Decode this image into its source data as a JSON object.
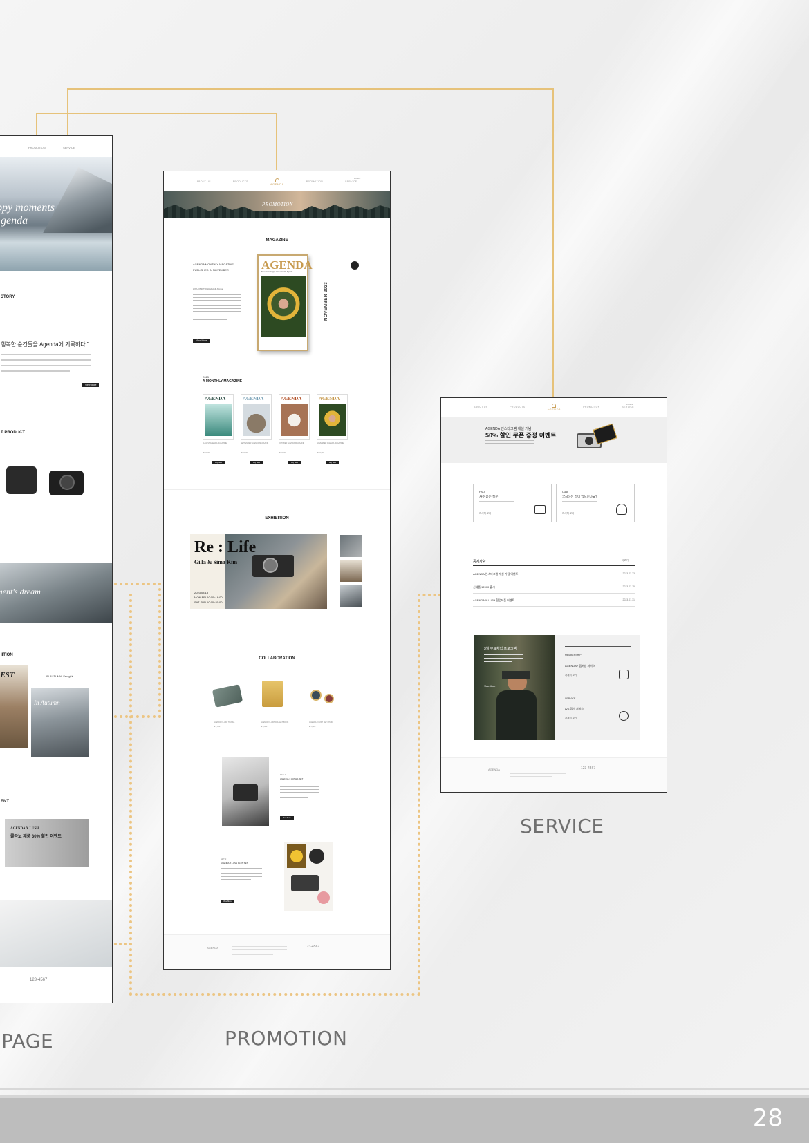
{
  "labels": {
    "page": "PAGE",
    "promotion": "PROMOTION",
    "service": "SERVICE"
  },
  "page_number": "28",
  "colors": {
    "connector": "#e6c27a",
    "dotted": "#ecc583",
    "footer_band": "#bdbdbd"
  },
  "left_mockup": {
    "story_heading": "STORY",
    "story_quote": "행복한 순간들을 Agenda에 기록하다.\"",
    "product_heading": "T PRODUCT",
    "exhibition_heading": "IITION",
    "event_heading": "ENT",
    "hero_text": "ppy moments",
    "hero_text2": "genda",
    "dream_text": "ment's dream",
    "forest_text": "REST",
    "autumn_title": "IN AUTUMN, Seulgi K",
    "autumn_art": "In Autumn",
    "event_title": "AGENDA X LUSH",
    "event_sub": "콜라보 제품 30% 할인 이벤트",
    "phone": "123-4567",
    "view_more": "View More"
  },
  "promo_mockup": {
    "nav": [
      "ABOUT US",
      "PRODUCTS",
      "PROMOTION",
      "SERVICE"
    ],
    "logo": "AGENDA",
    "login": "LOGIN",
    "banner": "PROMOTION",
    "magazine_heading": "MAGAZINE",
    "magazine_title1": "AGENDA MONTHLY MAGAZINE",
    "magazine_title2": "PUBLISHED IN NOVEMBER",
    "magazine_with": "WITH PHOTOGRAPHER Agnes",
    "cover_title": "AGENDA",
    "cover_sub": "To record a happy moments with Agenda",
    "vertical_text": "NOVEMBER 2023",
    "view_more": "View More",
    "monthly_year": "2023",
    "monthly_heading": "A MONTHLY MAGAZINE",
    "magazines": [
      {
        "name": "AUGUST AGENDA MAGAZINE",
        "price": "₩ 15,000",
        "btn": "Buy Now"
      },
      {
        "name": "SEPTEMBER AGENDA MAGAZINE",
        "price": "₩ 15,000",
        "btn": "Buy Now"
      },
      {
        "name": "OCTOBER AGENDA MAGAZINE",
        "price": "₩ 15,000",
        "btn": "Buy Now"
      },
      {
        "name": "NOVEMBER AGENDA MAGAZINE",
        "price": "₩ 15,000",
        "btn": "Buy Now"
      }
    ],
    "mag_cover": "AGENDA",
    "exhibition_heading": "EXHIBITION",
    "exhibit_title": "Re : Life",
    "exhibit_artist": "Gilla & Sima Kim",
    "exhibit_date": "2023.03.13",
    "exhibit_hours1": "MON-FRI 10:00~18:00",
    "exhibit_hours2": "SAT-SUN 10:00~20:00",
    "collaboration_heading": "COLLABORATION",
    "collab_items": [
      {
        "name": "AGENDA X LUSH TRAVEL",
        "price": "₩ 7,000"
      },
      {
        "name": "AGENDA X LUSH COLLECT BOOK",
        "price": "₩ 9,000"
      },
      {
        "name": "AGENDA X LUSH KEY CHAIN",
        "price": "₩ 5,000"
      }
    ],
    "set1_label": "SET 1",
    "set1_title": "AGENDA X LUSH 1 SET",
    "set2_label": "SET 2",
    "set2_title": "AGENDA X LUSH PLUS SET",
    "footer_logo": "AGENDA",
    "footer_phone": "123-4567"
  },
  "service_mockup": {
    "nav": [
      "ABOUT US",
      "PRODUCTS",
      "PROMOTION",
      "SERVICE"
    ],
    "logo": "AGENDA",
    "login": "LOGIN",
    "event_kicker": "AGENDA 인스타그램 개설 기념",
    "event_title": "50% 할인 쿠폰 증정 이벤트",
    "faq_label": "FAQ",
    "faq_title": "자주 묻는 질문",
    "faq_link": "자세히 보기",
    "qa_label": "Q&A",
    "qa_title": "궁금하신 점이 있으신가요?",
    "qa_link": "자세히 보기",
    "notice_heading": "공지사항",
    "notice_more": "더보기",
    "notices": [
      {
        "title": "AGENDA 인스타그램 개설 기념 이벤트",
        "date": "2023.03.23"
      },
      {
        "title": "신제품 12000 출시",
        "date": "2023.02.15"
      },
      {
        "title": "AGENDA X LUSH 협업제품 이벤트",
        "date": "2023.01.31"
      }
    ],
    "program_title": "3월 무료체험 프로그램",
    "program_btn": "View More",
    "membership_label": "MEMBERSHIP",
    "membership_desc": "AGENDA+ 멤버십 서비스",
    "membership_link": "자세히 보기",
    "service_label": "SERVICE",
    "service_desc": "A/S 접수 서비스",
    "service_link": "자세히 보기",
    "footer_logo": "AGENDA",
    "footer_phone": "123-4567"
  }
}
